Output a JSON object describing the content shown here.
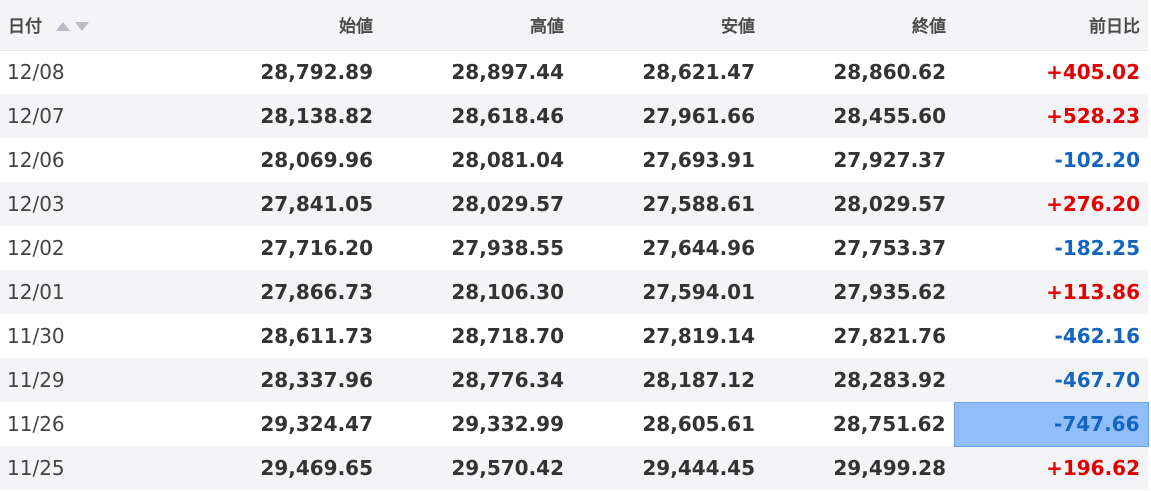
{
  "header": {
    "date": "日付",
    "open": "始値",
    "high": "高値",
    "low": "安値",
    "close": "終値",
    "change": "前日比",
    "sort_icons": [
      "sort-ascending-icon",
      "sort-descending-icon"
    ]
  },
  "colors": {
    "up": "#e00000",
    "down": "#1565c0",
    "selected_cell": "#8fbef8",
    "header_bg": "#f4f4f6",
    "stripe_bg": "#f4f4f6"
  },
  "rows": [
    {
      "date": "12/08",
      "open": "28,792.89",
      "high": "28,897.44",
      "low": "28,621.47",
      "close": "28,860.62",
      "change": "+405.02",
      "direction": "up",
      "selected": false
    },
    {
      "date": "12/07",
      "open": "28,138.82",
      "high": "28,618.46",
      "low": "27,961.66",
      "close": "28,455.60",
      "change": "+528.23",
      "direction": "up",
      "selected": false
    },
    {
      "date": "12/06",
      "open": "28,069.96",
      "high": "28,081.04",
      "low": "27,693.91",
      "close": "27,927.37",
      "change": "-102.20",
      "direction": "down",
      "selected": false
    },
    {
      "date": "12/03",
      "open": "27,841.05",
      "high": "28,029.57",
      "low": "27,588.61",
      "close": "28,029.57",
      "change": "+276.20",
      "direction": "up",
      "selected": false
    },
    {
      "date": "12/02",
      "open": "27,716.20",
      "high": "27,938.55",
      "low": "27,644.96",
      "close": "27,753.37",
      "change": "-182.25",
      "direction": "down",
      "selected": false
    },
    {
      "date": "12/01",
      "open": "27,866.73",
      "high": "28,106.30",
      "low": "27,594.01",
      "close": "27,935.62",
      "change": "+113.86",
      "direction": "up",
      "selected": false
    },
    {
      "date": "11/30",
      "open": "28,611.73",
      "high": "28,718.70",
      "low": "27,819.14",
      "close": "27,821.76",
      "change": "-462.16",
      "direction": "down",
      "selected": false
    },
    {
      "date": "11/29",
      "open": "28,337.96",
      "high": "28,776.34",
      "low": "28,187.12",
      "close": "28,283.92",
      "change": "-467.70",
      "direction": "down",
      "selected": false
    },
    {
      "date": "11/26",
      "open": "29,324.47",
      "high": "29,332.99",
      "low": "28,605.61",
      "close": "28,751.62",
      "change": "-747.66",
      "direction": "down",
      "selected": true
    },
    {
      "date": "11/25",
      "open": "29,469.65",
      "high": "29,570.42",
      "low": "29,444.45",
      "close": "29,499.28",
      "change": "+196.62",
      "direction": "up",
      "selected": false
    }
  ]
}
